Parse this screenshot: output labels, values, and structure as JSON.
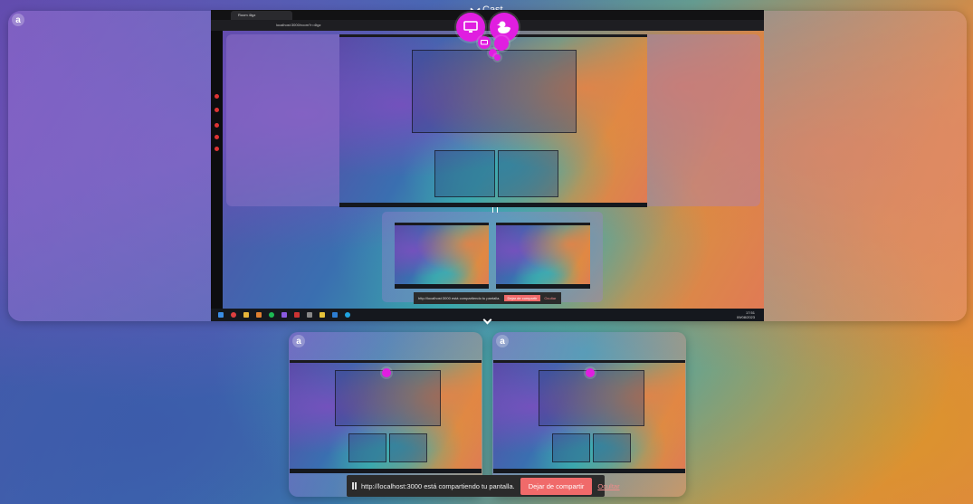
{
  "cast": {
    "label": "Cast",
    "avatar_letter": "a",
    "screen_icon": "monitor-icon",
    "duck_icon": "duck-icon",
    "accent_color": "#e01ee0"
  },
  "inner_browser": {
    "tab_title": "Room 4tgz",
    "url": "localhost:3000/room?r=4tgz"
  },
  "share_bar": {
    "message": "http://localhost:3000 está compartiendo tu pantalla.",
    "stop_label": "Dejar de compartir",
    "hide_label": "Ocultar"
  },
  "small_share_bar": {
    "message": "http://localhost:3000 está compartiendo tu pantalla.",
    "stop_label": "Dejar de compartir",
    "hide_label": "Ocultar"
  },
  "taskbar": {
    "time": "17:51",
    "date": "09/08/2023"
  }
}
